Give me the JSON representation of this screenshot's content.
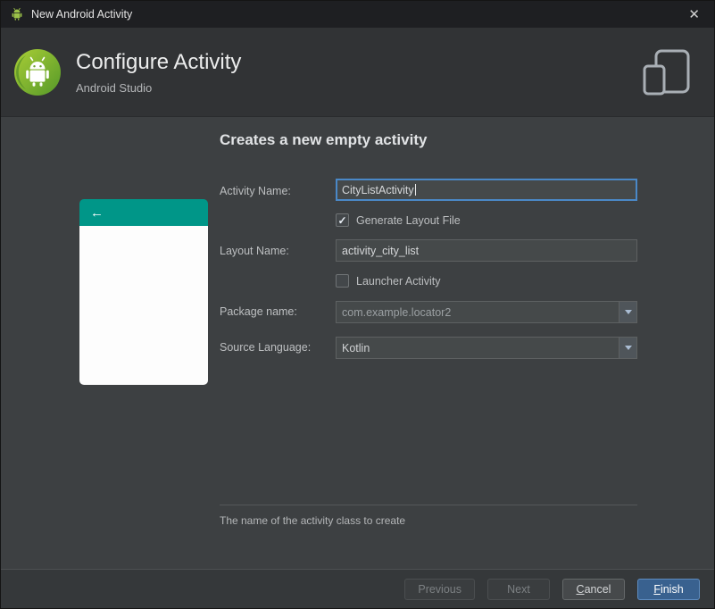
{
  "window": {
    "title": "New Android Activity"
  },
  "icons": {
    "close": "✕",
    "check": "✓",
    "back": "←"
  },
  "banner": {
    "title": "Configure Activity",
    "subtitle": "Android Studio"
  },
  "main": {
    "heading": "Creates a new empty activity",
    "activity_name": {
      "label": "Activity Name:",
      "value": "CityListActivity"
    },
    "generate_layout": {
      "label": "Generate Layout File",
      "checked": true
    },
    "layout_name": {
      "label": "Layout Name:",
      "value": "activity_city_list"
    },
    "launcher_activity": {
      "label": "Launcher Activity",
      "checked": false
    },
    "package_name": {
      "label": "Package name:",
      "value": "com.example.locator2"
    },
    "source_language": {
      "label": "Source Language:",
      "value": "Kotlin"
    },
    "helper_text": "The name of the activity class to create"
  },
  "footer": {
    "previous": "Previous",
    "next": "Next",
    "cancel": "Cancel",
    "finish": "Finish"
  },
  "colors": {
    "preview_accent_teal": "#009688",
    "focus_border_blue": "#4a88c7",
    "primary_button_blue": "#39618f",
    "banner_bg": "#313335",
    "content_bg": "#3d4042",
    "titlebar_bg": "#1e1f22"
  }
}
